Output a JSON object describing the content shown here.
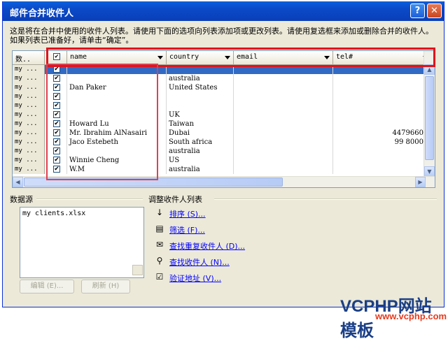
{
  "window": {
    "title": "邮件合并收件人",
    "help_label": "?",
    "close_label": "✕"
  },
  "description": "这是将在合并中使用的收件人列表。请使用下面的选项向列表添加项或更改列表。请使用复选框来添加或删除合并的收件人。如果列表已准备好，请单击“确定”。",
  "grid": {
    "columns": [
      "数..",
      "",
      "name",
      "country",
      "email",
      "tel#"
    ],
    "rows": [
      {
        "src": "my ...",
        "checked": true,
        "name": "",
        "country": "",
        "email": "",
        "tel": "",
        "selected": true
      },
      {
        "src": "my ...",
        "checked": true,
        "name": "",
        "country": "australia",
        "email": "",
        "tel": ""
      },
      {
        "src": "my ...",
        "checked": true,
        "name": "Dan Paker",
        "country": "United States",
        "email": "",
        "tel": ""
      },
      {
        "src": "my ...",
        "checked": true,
        "name": "",
        "country": "",
        "email": "",
        "tel": ""
      },
      {
        "src": "my ...",
        "checked": true,
        "name": "",
        "country": "",
        "email": "",
        "tel": ""
      },
      {
        "src": "my ...",
        "checked": true,
        "name": "",
        "country": "UK",
        "email": "",
        "tel": ""
      },
      {
        "src": "my ...",
        "checked": true,
        "name": "Howard Lu",
        "country": "Taiwan",
        "email": "",
        "tel": ""
      },
      {
        "src": "my ...",
        "checked": true,
        "name": "Mr. Ibrahim AlNasairi",
        "country": "Dubai",
        "email": "",
        "tel": "4479660"
      },
      {
        "src": "my ...",
        "checked": true,
        "name": "Jaco Estebeth",
        "country": "South africa",
        "email": "",
        "tel": "99 8000"
      },
      {
        "src": "my ...",
        "checked": true,
        "name": "",
        "country": "australia",
        "email": "",
        "tel": ""
      },
      {
        "src": "my ...",
        "checked": true,
        "name": "Winnie Cheng",
        "country": "US",
        "email": "",
        "tel": ""
      },
      {
        "src": "my ...",
        "checked": true,
        "name": "W.M",
        "country": "australia",
        "email": "",
        "tel": ""
      }
    ]
  },
  "datasource": {
    "title": "数据源",
    "items": [
      "my clients.xlsx"
    ],
    "edit_label": "编辑 (E)...",
    "refresh_label": "刷新 (H)"
  },
  "refine": {
    "title": "调整收件人列表",
    "links": [
      {
        "label": "排序 (S)...",
        "icon": "sort-icon",
        "glyph": "↓"
      },
      {
        "label": "筛选 (F)...",
        "icon": "filter-icon",
        "glyph": "▤"
      },
      {
        "label": "查找重复收件人 (D)...",
        "icon": "duplicates-icon",
        "glyph": "✉"
      },
      {
        "label": "查找收件人 (N)...",
        "icon": "find-recipient-icon",
        "glyph": "⚲"
      },
      {
        "label": "验证地址 (V)...",
        "icon": "validate-icon",
        "glyph": "☑"
      }
    ]
  },
  "watermark": {
    "main": "VCPHP网站模板",
    "sub": "www.vcphp.com"
  },
  "colors": {
    "title_bar": "#0a4fd0",
    "highlight": "#e0141c",
    "link": "#0000ff"
  }
}
